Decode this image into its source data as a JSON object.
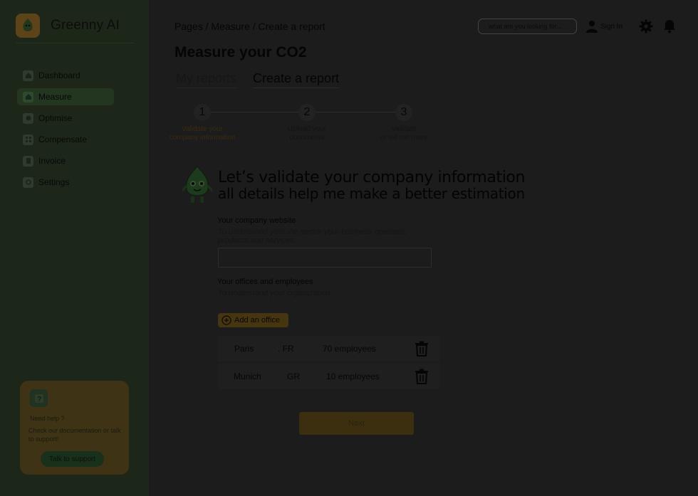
{
  "app": {
    "brand": "Greenny AI"
  },
  "sidebar": {
    "items": [
      {
        "label": "Dashboard",
        "icon": "home-icon"
      },
      {
        "label": "Measure",
        "icon": "measure-icon",
        "active": true
      },
      {
        "label": "Optimise",
        "icon": "optimise-icon"
      },
      {
        "label": "Compensate",
        "icon": "grid-icon"
      },
      {
        "label": "Invoice",
        "icon": "invoice-icon"
      },
      {
        "label": "Settings",
        "icon": "settings-icon"
      }
    ],
    "help": {
      "title": "Need help ?",
      "text": "Check our documentation or talk to support!",
      "button": "Talk to support"
    }
  },
  "header": {
    "breadcrumb": [
      "Pages",
      "Measure",
      "Create a report"
    ],
    "search_placeholder": "what are you looking for...",
    "signin_label": "Sign In"
  },
  "page": {
    "title": "Measure your CO2",
    "tabs": [
      {
        "label": "My reports",
        "active": false
      },
      {
        "label": "Create a report",
        "active": true
      }
    ]
  },
  "stepper": [
    {
      "number": "1",
      "line1": "Validate your",
      "line2": "company information",
      "active": true
    },
    {
      "number": "2",
      "line1": "Upload your",
      "line2": "documents",
      "active": false
    },
    {
      "number": "3",
      "line1": "Validate",
      "line2": "or tell me more",
      "active": false
    }
  ],
  "form": {
    "heading_line1": "Let’s validate your company information",
    "heading_line2": "all details help me make a better estimation",
    "website": {
      "label": "Your company website",
      "hint": "To understand your the sector your business operates, products and services.",
      "value": ""
    },
    "offices": {
      "label": "Your offices and employees",
      "hint": "To understand your organization",
      "add_label": "Add an office",
      "rows": [
        {
          "city": "Paris",
          "country": ". FR",
          "employees": "70 employees"
        },
        {
          "city": "Munich",
          "country": "GR",
          "employees": "10 employees"
        }
      ]
    },
    "next_label": "Next"
  },
  "colors": {
    "sidebar_bg": "#1d2719",
    "accent_orange": "#46360f",
    "accent_green": "#19301b",
    "page_bg": "#1c1c1c"
  }
}
